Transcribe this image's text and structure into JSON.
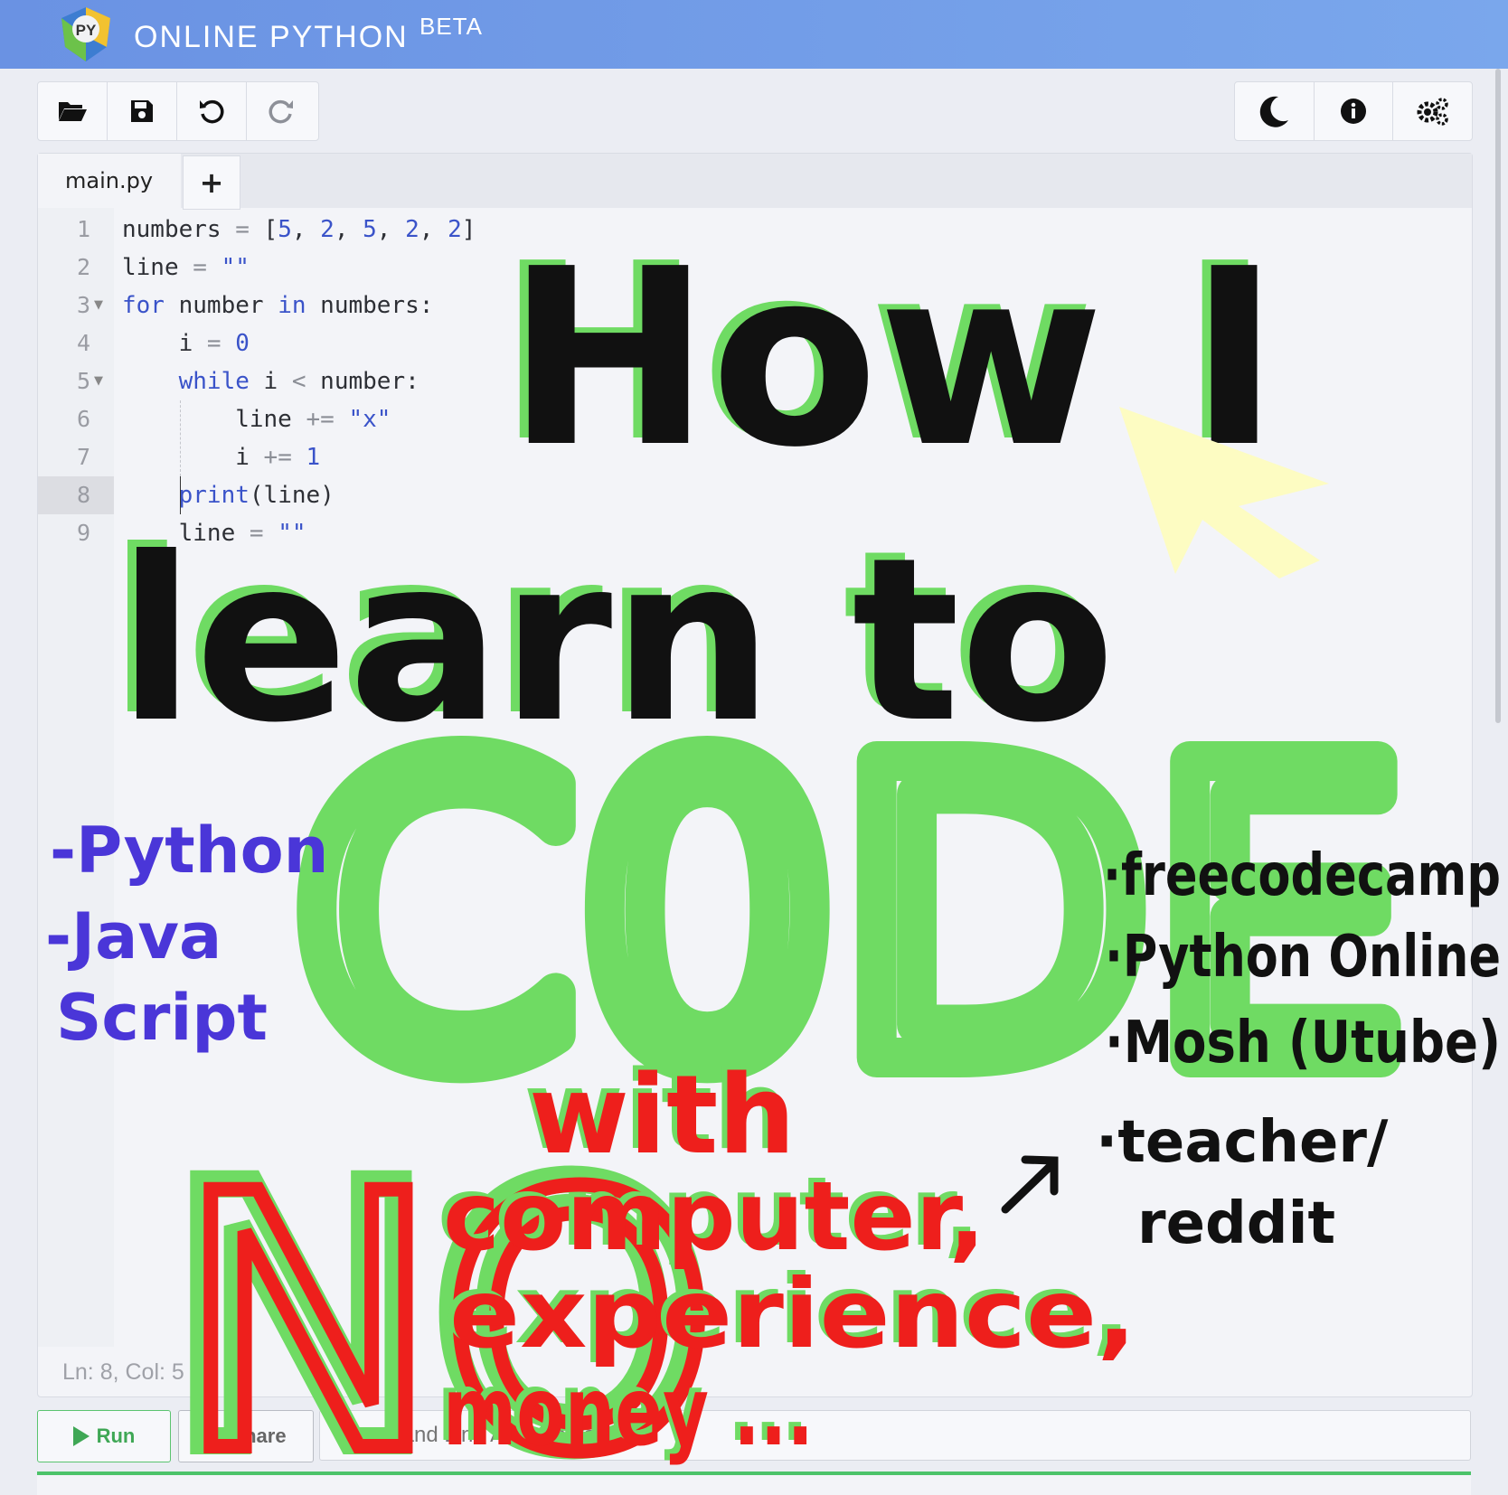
{
  "header": {
    "title": "ONLINE PYTHON",
    "badge": "BETA",
    "logo_text": "PY"
  },
  "toolbar_left": [
    "folder-open-icon",
    "save-icon",
    "undo-icon",
    "redo-icon"
  ],
  "toolbar_right": [
    "moon-icon",
    "info-icon",
    "gears-icon"
  ],
  "tabs": {
    "main_label": "main.py",
    "add_label": "+"
  },
  "editor": {
    "line_numbers": [
      "1",
      "2",
      "3",
      "4",
      "5",
      "6",
      "7",
      "8",
      "9"
    ],
    "status": "Ln: 8,  Col: 5"
  },
  "actions": {
    "run_label": "Run",
    "share_label": "Share",
    "command_placeholder": "Command Line Arguments"
  },
  "overlay": {
    "line1": "How I",
    "line2": "learn to",
    "code": "C0DE",
    "with": "with",
    "no": "NO",
    "computer": "computer,",
    "experience": "experience,",
    "money": "money ...",
    "left_list": [
      "-Python",
      "-Java",
      "Script"
    ],
    "right_list": [
      "·freecodecamp",
      "·Python Online",
      "·Mosh (Utube)",
      "·teacher/",
      "reddit"
    ]
  },
  "colors": {
    "green": "#6fdb63",
    "red": "#ee1f1c",
    "blue": "#4a36d8",
    "ink": "#111111",
    "yellow": "#fdfcc2"
  }
}
